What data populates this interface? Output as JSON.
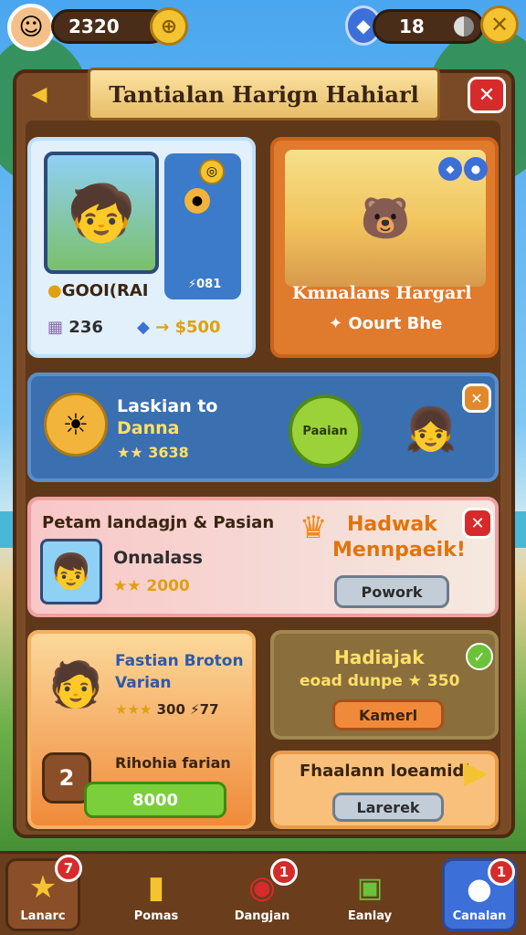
{
  "topbar": {
    "coins": "2320",
    "gems": "18",
    "coin_icon": "coin-icon",
    "gem_icon": "blue-gem-icon"
  },
  "panel": {
    "title": "Tantialan Harign Hahiarl",
    "close": "✕",
    "back": "◀"
  },
  "card1": {
    "name": "GOOI(RAI",
    "stack_value": "236",
    "price": "$500",
    "side_value": "081"
  },
  "card2": {
    "title": "Kmnalans Hargarl",
    "subtitle": "Oourt Bhe"
  },
  "card3": {
    "title": "Laskian to",
    "subtitle": "Danna",
    "stars": "★★",
    "value": "3638",
    "button": "Paaian",
    "close": "✕"
  },
  "card4": {
    "header": "Petam landagjn & Pasian",
    "name": "Onnalass",
    "stars": "★★",
    "value": "2000",
    "headline_1": "Hadwak",
    "headline_2": "Mennpaeik!",
    "button": "Powork",
    "close": "✕"
  },
  "card5": {
    "title_1": "Fastian Broton",
    "title_2": "Varian",
    "stars": "★★★",
    "value_1": "300",
    "value_2": "77",
    "subtitle": "Rihohia farian",
    "button": "8000",
    "rank": "2"
  },
  "card6": {
    "title": "Hadiajak",
    "subtitle": "eoad dunpe",
    "value": "350",
    "button": "Kamerl",
    "check": "✓"
  },
  "card7": {
    "title": "Fhaalann loeamidl",
    "button": "Larerek"
  },
  "nav": [
    {
      "label": "Lanarc",
      "badge": "7"
    },
    {
      "label": "Pomas",
      "badge": ""
    },
    {
      "label": "Dangjan",
      "badge": "1"
    },
    {
      "label": "Eanlay",
      "badge": ""
    },
    {
      "label": "Canalan",
      "badge": "1"
    }
  ],
  "colors": {
    "wood": "#7a4a26",
    "gold": "#f4c430",
    "red": "#d72b2b",
    "green": "#6cc23a",
    "blue_card": "#3a6fb0"
  }
}
